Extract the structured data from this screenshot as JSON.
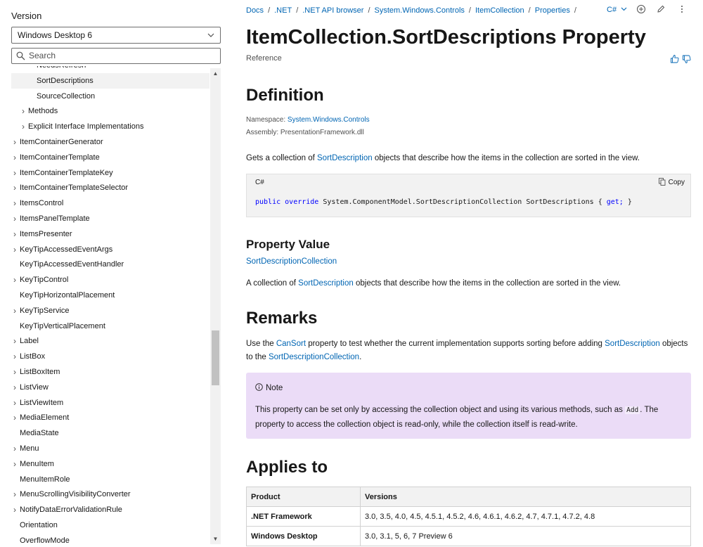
{
  "sidebar": {
    "version_label": "Version",
    "version_value": "Windows Desktop 6",
    "search_placeholder": "Search",
    "toc": [
      {
        "label": "NeedsRefresh",
        "level": 2,
        "arrow": false,
        "selected": false
      },
      {
        "label": "SortDescriptions",
        "level": 2,
        "arrow": false,
        "selected": true
      },
      {
        "label": "SourceCollection",
        "level": 2,
        "arrow": false,
        "selected": false
      },
      {
        "label": "Methods",
        "level": 1,
        "arrow": true,
        "selected": false
      },
      {
        "label": "Explicit Interface Implementations",
        "level": 1,
        "arrow": true,
        "selected": false
      },
      {
        "label": "ItemContainerGenerator",
        "level": 0,
        "arrow": true,
        "selected": false
      },
      {
        "label": "ItemContainerTemplate",
        "level": 0,
        "arrow": true,
        "selected": false
      },
      {
        "label": "ItemContainerTemplateKey",
        "level": 0,
        "arrow": true,
        "selected": false
      },
      {
        "label": "ItemContainerTemplateSelector",
        "level": 0,
        "arrow": true,
        "selected": false
      },
      {
        "label": "ItemsControl",
        "level": 0,
        "arrow": true,
        "selected": false
      },
      {
        "label": "ItemsPanelTemplate",
        "level": 0,
        "arrow": true,
        "selected": false
      },
      {
        "label": "ItemsPresenter",
        "level": 0,
        "arrow": true,
        "selected": false
      },
      {
        "label": "KeyTipAccessedEventArgs",
        "level": 0,
        "arrow": true,
        "selected": false
      },
      {
        "label": "KeyTipAccessedEventHandler",
        "level": 0,
        "arrow": false,
        "selected": false
      },
      {
        "label": "KeyTipControl",
        "level": 0,
        "arrow": true,
        "selected": false
      },
      {
        "label": "KeyTipHorizontalPlacement",
        "level": 0,
        "arrow": false,
        "selected": false
      },
      {
        "label": "KeyTipService",
        "level": 0,
        "arrow": true,
        "selected": false
      },
      {
        "label": "KeyTipVerticalPlacement",
        "level": 0,
        "arrow": false,
        "selected": false
      },
      {
        "label": "Label",
        "level": 0,
        "arrow": true,
        "selected": false
      },
      {
        "label": "ListBox",
        "level": 0,
        "arrow": true,
        "selected": false
      },
      {
        "label": "ListBoxItem",
        "level": 0,
        "arrow": true,
        "selected": false
      },
      {
        "label": "ListView",
        "level": 0,
        "arrow": true,
        "selected": false
      },
      {
        "label": "ListViewItem",
        "level": 0,
        "arrow": true,
        "selected": false
      },
      {
        "label": "MediaElement",
        "level": 0,
        "arrow": true,
        "selected": false
      },
      {
        "label": "MediaState",
        "level": 0,
        "arrow": false,
        "selected": false
      },
      {
        "label": "Menu",
        "level": 0,
        "arrow": true,
        "selected": false
      },
      {
        "label": "MenuItem",
        "level": 0,
        "arrow": true,
        "selected": false
      },
      {
        "label": "MenuItemRole",
        "level": 0,
        "arrow": false,
        "selected": false
      },
      {
        "label": "MenuScrollingVisibilityConverter",
        "level": 0,
        "arrow": true,
        "selected": false
      },
      {
        "label": "NotifyDataErrorValidationRule",
        "level": 0,
        "arrow": true,
        "selected": false
      },
      {
        "label": "Orientation",
        "level": 0,
        "arrow": false,
        "selected": false
      },
      {
        "label": "OverflowMode",
        "level": 0,
        "arrow": false,
        "selected": false
      }
    ],
    "scroll_position": 0.63
  },
  "breadcrumb": [
    "Docs",
    ".NET",
    ".NET API browser",
    "System.Windows.Controls",
    "ItemCollection",
    "Properties"
  ],
  "breadcrumb_sep": "/",
  "language": "C#",
  "page": {
    "title": "ItemCollection.SortDescriptions Property",
    "reference": "Reference"
  },
  "definition": {
    "heading": "Definition",
    "namespace_label": "Namespace:",
    "namespace_value": "System.Windows.Controls",
    "assembly_label": "Assembly:",
    "assembly_value": "PresentationFramework.dll",
    "summary_pre": "Gets a collection of ",
    "summary_link": "SortDescription",
    "summary_post": " objects that describe how the items in the collection are sorted in the view."
  },
  "code": {
    "lang": "C#",
    "copy_label": "Copy",
    "kw1": "public",
    "kw2": "override",
    "body": "System.ComponentModel.SortDescriptionCollection SortDescriptions {",
    "kw3": "get;",
    "end": "}"
  },
  "property_value": {
    "heading": "Property Value",
    "type_link": "SortDescriptionCollection",
    "desc_pre": "A collection of ",
    "desc_link": "SortDescription",
    "desc_post": " objects that describe how the items in the collection are sorted in the view."
  },
  "remarks": {
    "heading": "Remarks",
    "p_pre": "Use the ",
    "link1": "CanSort",
    "p_mid": " property to test whether the current implementation supports sorting before adding ",
    "link2": "SortDescription",
    "p_mid2": " objects to the ",
    "link3": "SortDescriptionCollection",
    "p_end": "."
  },
  "note": {
    "title": "Note",
    "pre": "This property can be set only by accessing the collection object and using its various methods, such as ",
    "code": "Add",
    "post": ". The property to access the collection object is read-only, while the collection itself is read-write."
  },
  "applies_to": {
    "heading": "Applies to",
    "columns": [
      "Product",
      "Versions"
    ],
    "rows": [
      {
        "product": ".NET Framework",
        "versions": "3.0, 3.5, 4.0, 4.5, 4.5.1, 4.5.2, 4.6, 4.6.1, 4.6.2, 4.7, 4.7.1, 4.7.2, 4.8"
      },
      {
        "product": "Windows Desktop",
        "versions": "3.0, 3.1, 5, 6, 7 Preview 6"
      }
    ]
  },
  "colors": {
    "link": "#0065b3",
    "note_bg": "#ebdcf7",
    "keyword": "#0000ff"
  }
}
